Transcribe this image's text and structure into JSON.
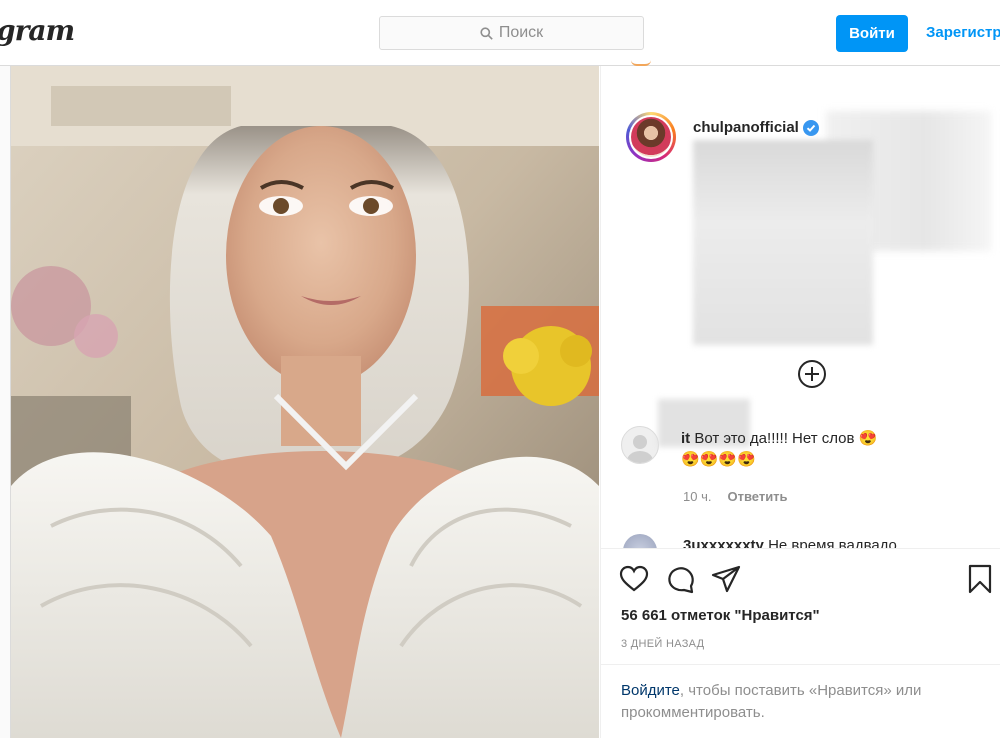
{
  "header": {
    "logo_text": "gram",
    "search_placeholder": "Поиск",
    "login_label": "Войти",
    "register_label": "Зарегистр"
  },
  "post": {
    "username": "chulpanofficial",
    "verified": true,
    "comment": {
      "username_tail": "it",
      "text": "Вот это да!!!!! Нет слов 😍",
      "emojis": "😍😍😍😍",
      "time": "10 ч.",
      "reply_label": "Ответить"
    },
    "next_comment_partial": {
      "username": "3uxxxxxxty",
      "text": "Не время вадвадо"
    },
    "likes": "56 661 отметок \"Нравится\"",
    "posted": "3 ДНЕЙ НАЗАД",
    "login_prompt": {
      "link": "Войдите",
      "rest": ", чтобы поставить «Нравится» или прокомментировать."
    }
  },
  "colors": {
    "accent": "#0095f6",
    "link_dark": "#00376b",
    "muted": "#8e8e8e"
  }
}
